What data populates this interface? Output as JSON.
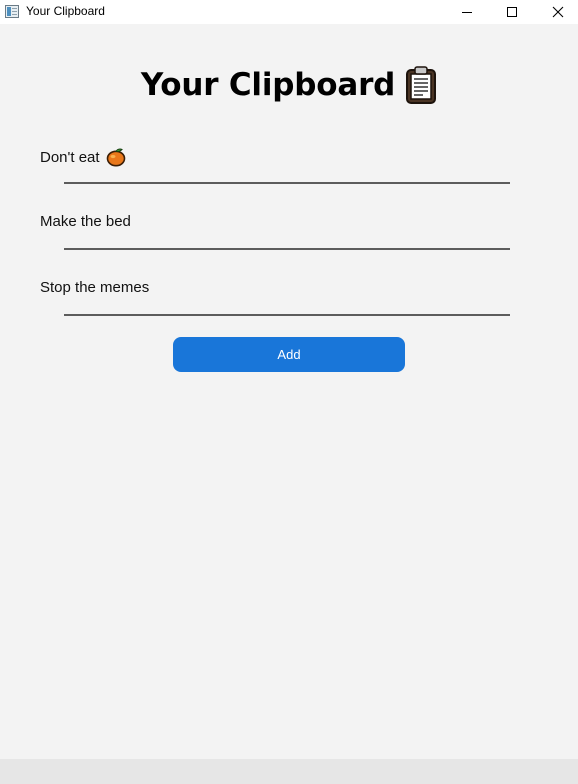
{
  "window": {
    "title": "Your Clipboard",
    "icon": "app-window-icon",
    "controls": {
      "minimize": "minimize-icon",
      "maximize": "maximize-icon",
      "close": "close-icon"
    }
  },
  "heading": {
    "text": "Your Clipboard",
    "icon": "clipboard-icon"
  },
  "items": [
    {
      "text": "Don't eat",
      "icon": "mango-icon"
    },
    {
      "text": "Make the bed"
    },
    {
      "text": "Stop the memes"
    }
  ],
  "add_button": {
    "label": "Add"
  },
  "colors": {
    "background": "#f3f3f3",
    "accent": "#1976d9",
    "underline": "#5c5c5c"
  }
}
